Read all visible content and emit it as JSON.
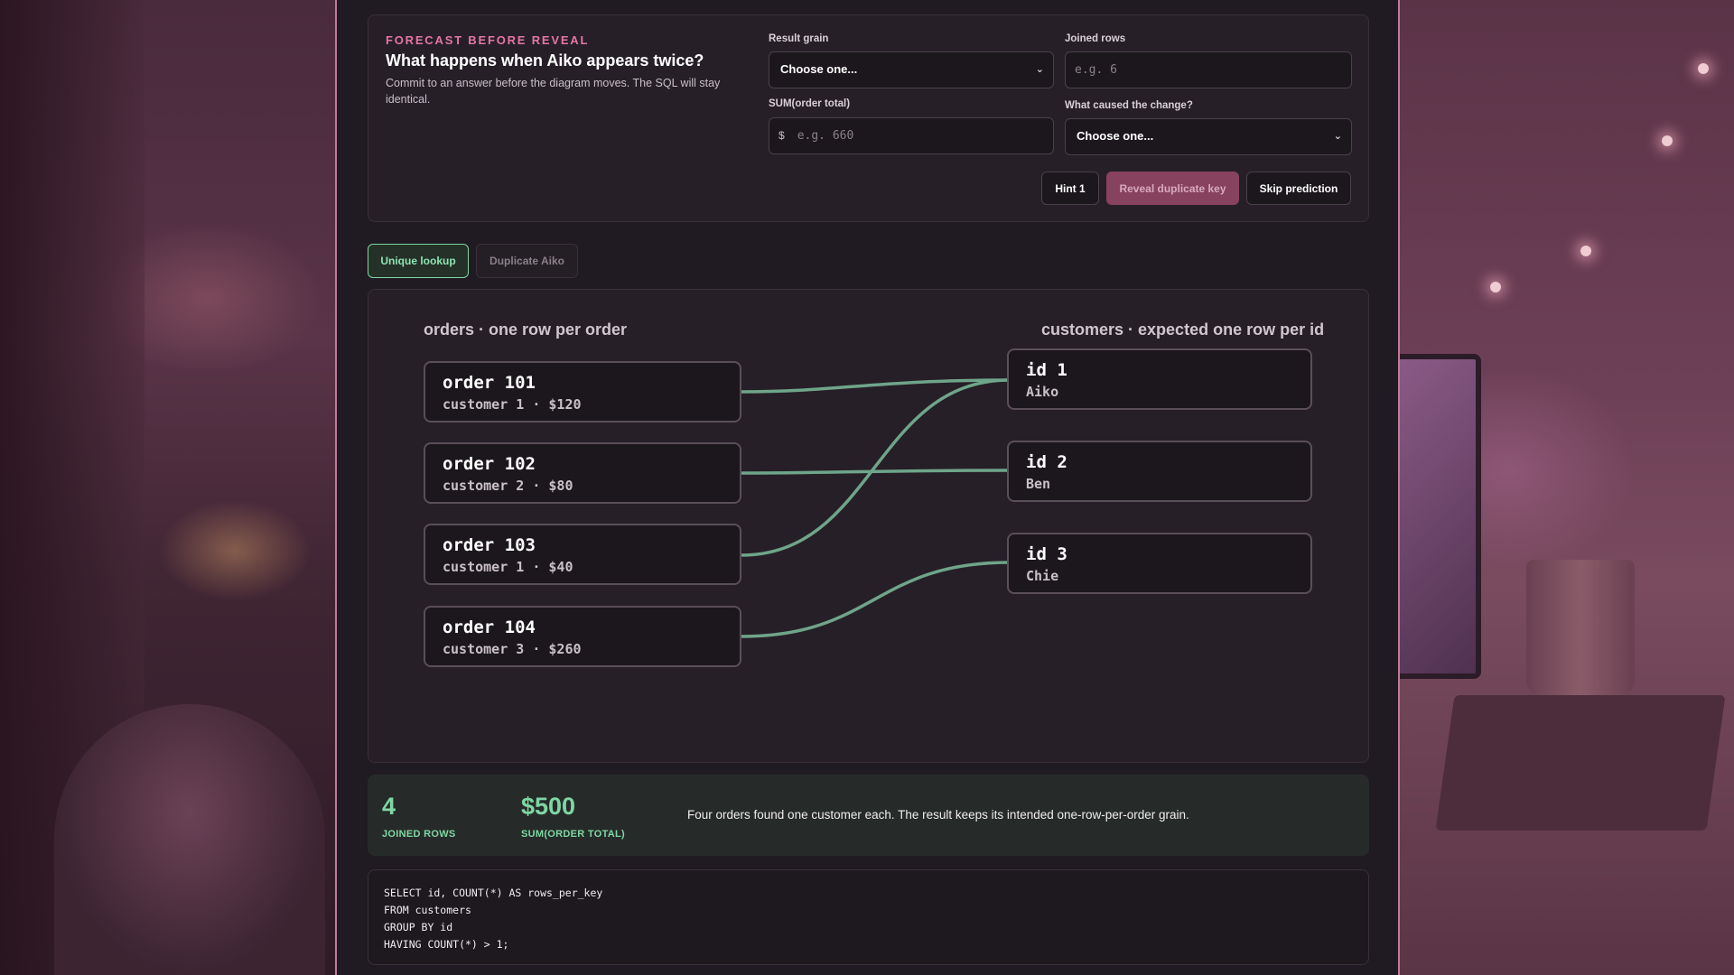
{
  "forecast": {
    "kicker": "FORECAST BEFORE REVEAL",
    "title": "What happens when Aiko appears twice?",
    "description": "Commit to an answer before the diagram moves. The SQL will stay identical.",
    "result_grain": {
      "label": "Result grain",
      "value": "Choose one..."
    },
    "joined_rows": {
      "label": "Joined rows",
      "placeholder": "e.g. 6"
    },
    "sum_total": {
      "label": "SUM(order total)",
      "prefix": "$",
      "placeholder": "e.g. 660"
    },
    "cause": {
      "label": "What caused the change?",
      "value": "Choose one..."
    },
    "buttons": {
      "hint": "Hint 1",
      "reveal": "Reveal duplicate key",
      "skip": "Skip prediction"
    }
  },
  "tabs": [
    {
      "label": "Unique lookup",
      "active": true
    },
    {
      "label": "Duplicate Aiko",
      "active": false
    }
  ],
  "diagram": {
    "left_heading": "orders · one row per order",
    "right_heading": "customers · expected one row per id",
    "orders": [
      {
        "title": "order 101",
        "detail": "customer 1 · $120"
      },
      {
        "title": "order 102",
        "detail": "customer 2 · $80"
      },
      {
        "title": "order 103",
        "detail": "customer 1 · $40"
      },
      {
        "title": "order 104",
        "detail": "customer 3 · $260"
      }
    ],
    "customers": [
      {
        "title": "id 1",
        "detail": "Aiko"
      },
      {
        "title": "id 2",
        "detail": "Ben"
      },
      {
        "title": "id 3",
        "detail": "Chie"
      }
    ],
    "link_color": "#6fa58a"
  },
  "summary": {
    "joined_rows_value": "4",
    "joined_rows_label": "JOINED ROWS",
    "sum_value": "$500",
    "sum_label": "SUM(ORDER TOTAL)",
    "text": "Four orders found one customer each. The result keeps its intended one-row-per-order grain."
  },
  "sql": {
    "lines": [
      "SELECT id, COUNT(*) AS rows_per_key",
      "FROM customers",
      "GROUP BY id",
      "HAVING COUNT(*) > 1;"
    ]
  },
  "colors": {
    "accent_pink": "#e476a4",
    "accent_green": "#7fd6a4"
  }
}
